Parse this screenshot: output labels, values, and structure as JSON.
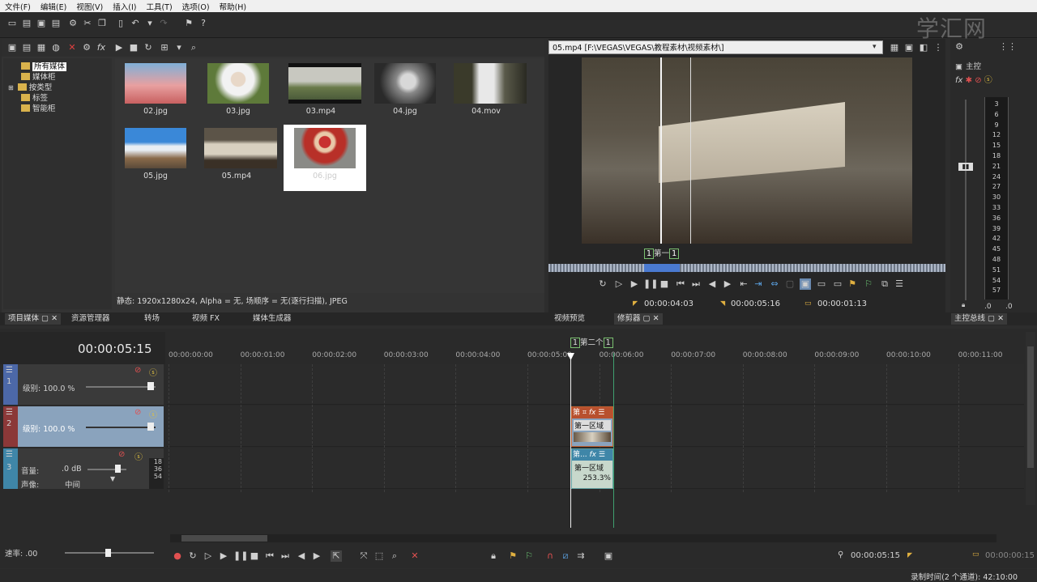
{
  "menu": [
    "文件(F)",
    "编辑(E)",
    "视图(V)",
    "插入(I)",
    "工具(T)",
    "选项(O)",
    "帮助(H)"
  ],
  "watermark": "学汇网",
  "media": {
    "tree": [
      "所有媒体",
      "媒体柜",
      "按类型",
      "标签",
      "智能柜"
    ],
    "thumbnails": [
      {
        "name": "02.jpg",
        "color": "#d89a9a"
      },
      {
        "name": "03.jpg",
        "color": "#7a8a5a"
      },
      {
        "name": "03.mp4",
        "color": "#8a8e84"
      },
      {
        "name": "04.jpg",
        "color": "#6b6b6b"
      },
      {
        "name": "04.mov",
        "color": "#6f6a60"
      },
      {
        "name": "05.jpg",
        "color": "#4f86c0"
      },
      {
        "name": "05.mp4",
        "color": "#8c8478"
      },
      {
        "name": "06.jpg",
        "color": "#9a6a4a"
      }
    ],
    "status": "静态: 1920x1280x24, Alpha = 无, 场顺序 = 无(逐行扫描), JPEG"
  },
  "preview": {
    "path": "05.mp4    [F:\\VEGAS\\VEGAS\\教程素材\\视频素材\\]",
    "region_label": "第一",
    "tc_in": "00:00:04:03",
    "tc_out": "00:00:05:16",
    "tc_len": "00:00:01:13"
  },
  "meter": {
    "title": "主控",
    "scale": [
      "3",
      "6",
      "9",
      "12",
      "15",
      "18",
      "21",
      "24",
      "27",
      "30",
      "33",
      "36",
      "39",
      "42",
      "45",
      "48",
      "51",
      "54",
      "57"
    ],
    "bottom_left": ".0",
    "bottom_right": ".0"
  },
  "tabs": {
    "left": [
      "项目媒体",
      "资源管理器",
      "转场",
      "视频 FX",
      "媒体生成器"
    ],
    "preview": "视频预览",
    "trimmer": "修剪器",
    "master": "主控总线"
  },
  "timeline": {
    "timecode": "00:00:05:15",
    "region_label": "第二个",
    "ruler": [
      "00:00:00:00",
      "00:00:01:00",
      "00:00:02:00",
      "00:00:03:00",
      "00:00:04:00",
      "00:00:05:00",
      "00:00:06:00",
      "00:00:07:00",
      "00:00:08:00",
      "00:00:09:00",
      "00:00:10:00",
      "00:00:11:00"
    ],
    "tracks": [
      {
        "num": "1",
        "level_label": "级别: 100.0 %",
        "color": "#4c68a8"
      },
      {
        "num": "2",
        "level_label": "级别: 100.0 %",
        "color": "#8b3838"
      },
      {
        "num": "3",
        "vol_label": "音量:",
        "vol_value": ".0 dB",
        "pan_label": "声像:",
        "pan_value": "中间",
        "color": "#3f86a8",
        "meter": [
          "18",
          "36",
          "54"
        ]
      }
    ],
    "clip2_title": "第",
    "clip2_sub": "第一区域",
    "clip3_title": "第...",
    "clip3_sub": "第一区域",
    "clip3_rate": "253.3%"
  },
  "bottom": {
    "rate_label": "速率: .00",
    "tc_cursor": "00:00:05:15",
    "tc_sel": "00:00:00:15"
  },
  "status": "录制时间(2 个通道): 42:10:00"
}
